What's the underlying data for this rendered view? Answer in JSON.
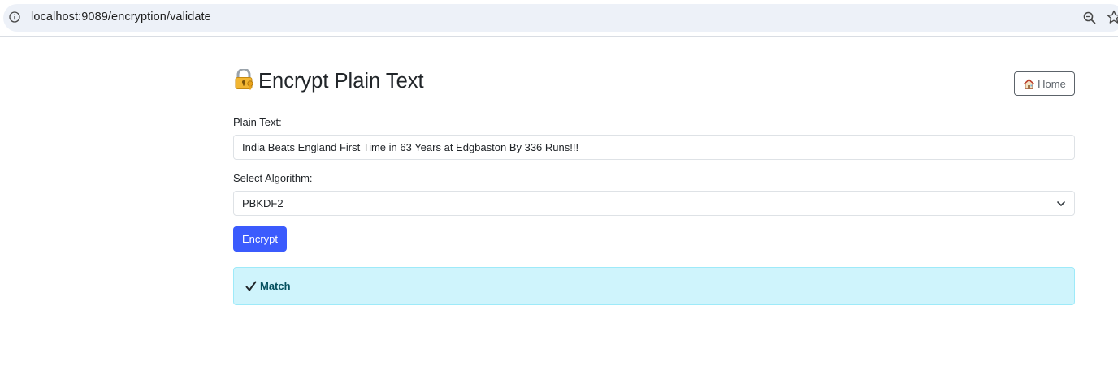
{
  "browser": {
    "url": "localhost:9089/encryption/validate"
  },
  "header": {
    "title": "Encrypt Plain Text",
    "home_label": "Home"
  },
  "form": {
    "plain_text_label": "Plain Text:",
    "plain_text_value": "India Beats England First Time in 63 Years at Edgbaston By 336 Runs!!!",
    "algorithm_label": "Select Algorithm:",
    "algorithm_selected": "PBKDF2",
    "encrypt_label": "Encrypt"
  },
  "result": {
    "message": "Match"
  },
  "colors": {
    "primary": "#3b5bfd",
    "info_bg": "#cff4fc",
    "info_border": "#9eeaf9",
    "info_text": "#055160"
  },
  "icons": {
    "title_icon": "locked-with-key-icon",
    "home_icon": "house-icon",
    "result_icon": "check-mark-icon"
  }
}
